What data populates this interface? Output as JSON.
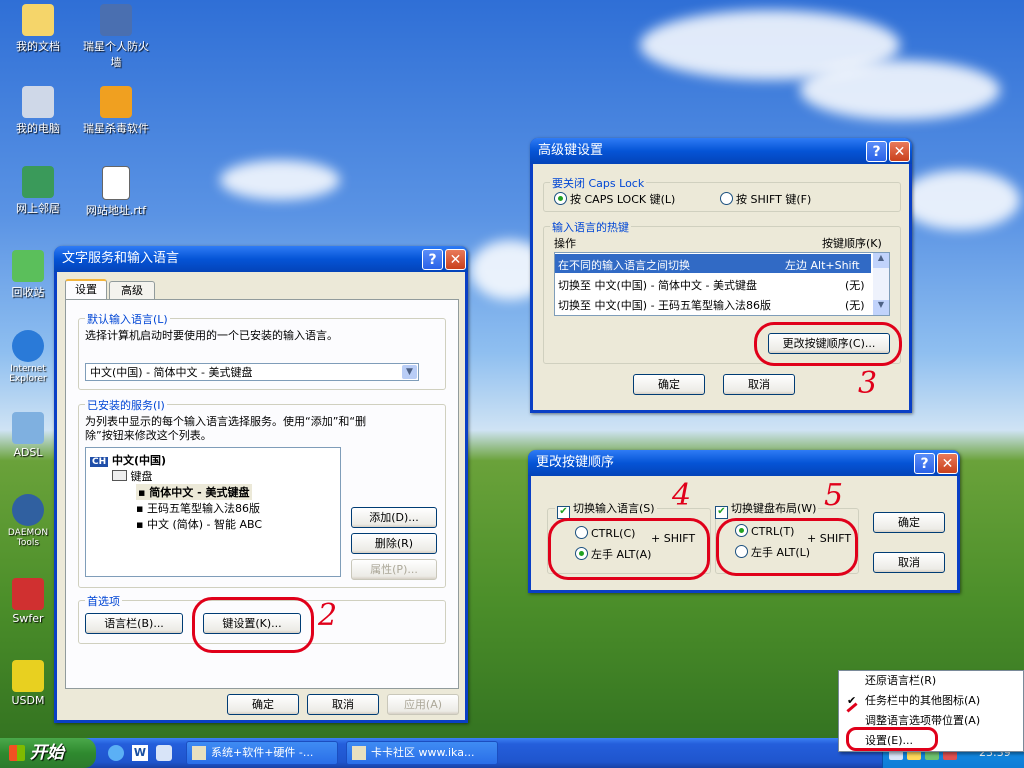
{
  "desktop": {
    "icons": [
      {
        "label": "我的文档",
        "icon": "folder-icon"
      },
      {
        "label": "瑞星个人防火墙",
        "icon": "firewall-icon"
      },
      {
        "label": "我的电脑",
        "icon": "computer-icon"
      },
      {
        "label": "瑞星杀毒软件",
        "icon": "antivirus-icon"
      },
      {
        "label": "网上邻居",
        "icon": "network-icon"
      },
      {
        "label": "网站地址.rtf",
        "icon": "document-icon"
      },
      {
        "label": "回收站",
        "icon": "recycle-bin-icon"
      },
      {
        "label": "Internet Explorer",
        "icon": "ie-icon"
      },
      {
        "label": "ADSL",
        "icon": "adsl-icon"
      },
      {
        "label": "DAEMON Tools",
        "icon": "daemon-icon"
      },
      {
        "label": "Swfer",
        "icon": "swfer-icon"
      },
      {
        "label": "USDM",
        "icon": "usdm-icon"
      }
    ]
  },
  "text_services": {
    "title": "文字服务和输入语言",
    "tabs": [
      "设置",
      "高级"
    ],
    "default_lang_group": "默认输入语言(L)",
    "default_lang_desc": "选择计算机启动时要使用的一个已安装的输入语言。",
    "default_lang_value": "中文(中国) - 简体中文 - 美式键盘",
    "installed_group": "已安装的服务(I)",
    "installed_desc1": "为列表中显示的每个输入语言选择服务。使用“添加”和“删",
    "installed_desc2": "除”按钮来修改这个列表。",
    "tree_lang_badge": "CH",
    "tree_lang": "中文(中国)",
    "tree_keyboard": "键盘",
    "tree_items": [
      "简体中文 - 美式键盘",
      "王码五笔型输入法86版",
      "中文 (简体) - 智能 ABC"
    ],
    "add": "添加(D)...",
    "remove": "删除(R)",
    "props": "属性(P)...",
    "prefs_group": "首选项",
    "langbar": "语言栏(B)...",
    "keysettings": "键设置(K)...",
    "ok": "确定",
    "cancel": "取消",
    "apply": "应用(A)"
  },
  "adv_keys": {
    "title": "高级键设置",
    "capslock_group": "要关闭 Caps Lock",
    "opt_caps": "按 CAPS LOCK 键(L)",
    "opt_shift": "按 SHIFT 键(F)",
    "hotkey_group": "输入语言的热键",
    "col_action": "操作",
    "col_keys": "按键顺序(K)",
    "rows": [
      {
        "action": "在不同的输入语言之间切换",
        "keys": "左边 Alt+Shift"
      },
      {
        "action": "切换至 中文(中国) - 简体中文 - 美式键盘",
        "keys": "(无)"
      },
      {
        "action": "切换至 中文(中国) - 王码五笔型输入法86版",
        "keys": "(无)"
      }
    ],
    "change_btn": "更改按键顺序(C)...",
    "ok": "确定",
    "cancel": "取消"
  },
  "change_seq": {
    "title": "更改按键顺序",
    "switch_lang": "切换输入语言(S)",
    "switch_layout": "切换键盘布局(W)",
    "ctrl_c": "CTRL(C)",
    "alt_a": "左手 ALT(A)",
    "ctrl_t": "CTRL(T)",
    "alt_l": "左手 ALT(L)",
    "plus_shift": "+ SHIFT",
    "ok": "确定",
    "cancel": "取消"
  },
  "annotations": {
    "n2": "2",
    "n3": "3",
    "n4": "4",
    "n5": "5"
  },
  "taskbar": {
    "start": "开始",
    "tasks": [
      "系统+软件+硬件 -...",
      "卡卡社区 www.ika..."
    ],
    "clock": "23:39"
  },
  "context_menu": {
    "items": [
      "还原语言栏(R)",
      "任务栏中的其他图标(A)",
      "调整语言选项带位置(A)",
      "设置(E)..."
    ]
  }
}
